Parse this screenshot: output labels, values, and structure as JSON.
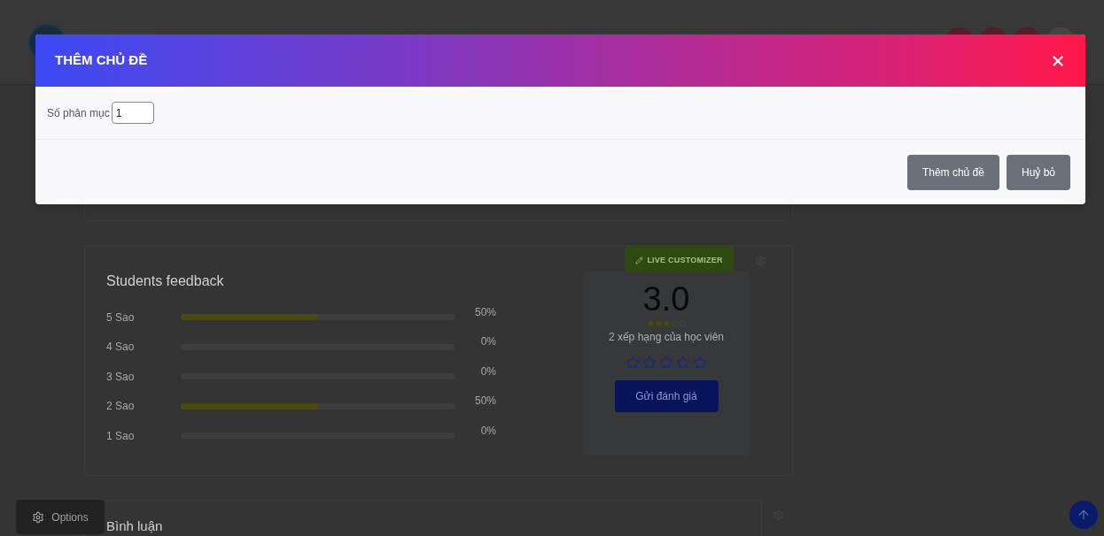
{
  "modal": {
    "title": "THÊM CHỦ ĐỀ",
    "field": {
      "label": "Số phân mục",
      "value": "1"
    },
    "buttons": [
      "Thêm chủ đề",
      "Huỷ bỏ"
    ]
  },
  "feedback": {
    "title": "Students feedback",
    "rows": [
      {
        "label": "5 Sao",
        "level": 0.5,
        "reading": "50%"
      },
      {
        "label": "4 Sao",
        "level": 0,
        "reading": "0%"
      },
      {
        "label": "3 Sao",
        "level": 0,
        "reading": "0%"
      },
      {
        "label": "2 Sao",
        "level": 0.5,
        "reading": "50%"
      },
      {
        "label": "1 Sao",
        "level": 0,
        "reading": "0%"
      }
    ],
    "customizer": "LIVE CUSTOMIZER",
    "rating": {
      "score": "3.0",
      "stars": 3,
      "caption": "2 xếp hạng của học viên",
      "button": "Gửi đánh giá"
    }
  },
  "comments": {
    "title": "Bình luận"
  },
  "options_button": "Options"
}
